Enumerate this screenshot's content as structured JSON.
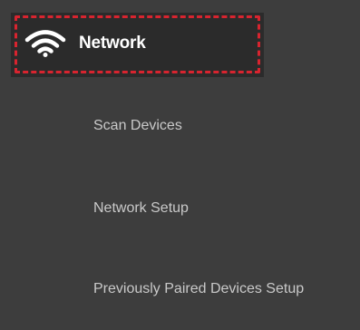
{
  "header": {
    "title": "Network",
    "icon": "wifi-icon",
    "highlight_color": "#d8242f"
  },
  "menu": {
    "items": [
      {
        "label": "Scan Devices"
      },
      {
        "label": "Network Setup"
      },
      {
        "label": "Previously Paired Devices Setup"
      }
    ]
  }
}
